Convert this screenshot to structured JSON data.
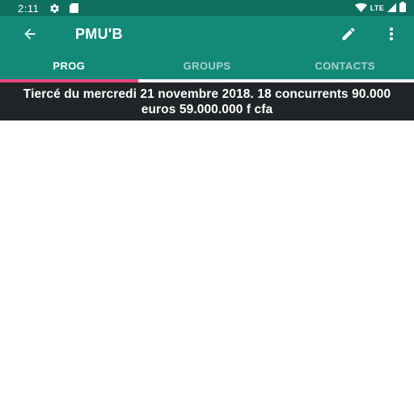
{
  "status_bar": {
    "time": "2:11",
    "network_label": "LTE",
    "icons": [
      "settings-gear-icon",
      "sim-card-icon",
      "wifi-icon",
      "signal-icon",
      "battery-icon"
    ]
  },
  "app_bar": {
    "title": "PMU'B",
    "icons": [
      "back-arrow-icon",
      "edit-pencil-icon",
      "more-vertical-icon"
    ]
  },
  "tabs": [
    {
      "label": "PROG",
      "active": true
    },
    {
      "label": "GROUPS",
      "active": false
    },
    {
      "label": "CONTACTS",
      "active": false
    }
  ],
  "banner": {
    "text": "Tiercé du mercredi 21 novembre 2018. 18 concurrents 90.000 euros 59.000.000 f cfa"
  },
  "colors": {
    "status_bar": "#0f6f61",
    "app_bar": "#138a78",
    "tab_indicator": "#e8467c",
    "banner": "#202426"
  }
}
